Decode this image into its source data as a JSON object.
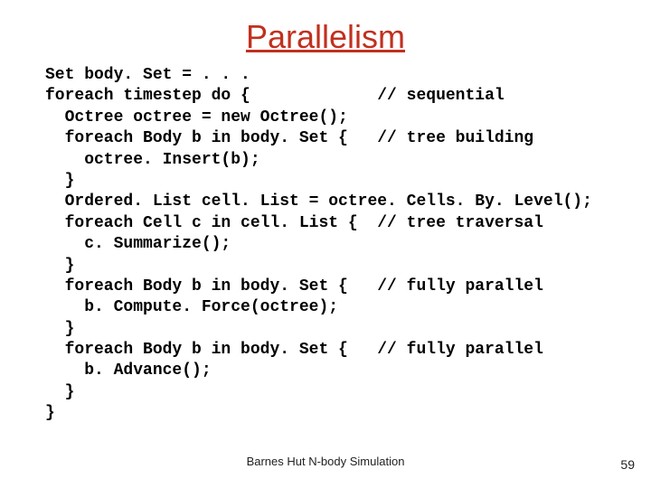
{
  "title": "Parallelism",
  "code_lines": [
    "Set body. Set = . . .",
    "foreach timestep do {             // sequential",
    "  Octree octree = new Octree();",
    "  foreach Body b in body. Set {   // tree building",
    "    octree. Insert(b);",
    "  }",
    "  Ordered. List cell. List = octree. Cells. By. Level();",
    "  foreach Cell c in cell. List {  // tree traversal",
    "    c. Summarize();",
    "  }",
    "  foreach Body b in body. Set {   // fully parallel",
    "    b. Compute. Force(octree);",
    "  }",
    "  foreach Body b in body. Set {   // fully parallel",
    "    b. Advance();",
    "  }",
    "}"
  ],
  "footer": "Barnes Hut N-body Simulation",
  "page_number": "59"
}
